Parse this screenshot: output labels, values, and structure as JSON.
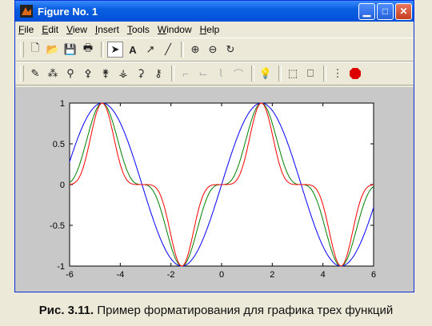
{
  "window": {
    "title": "Figure No. 1"
  },
  "menu": [
    "File",
    "Edit",
    "View",
    "Insert",
    "Tools",
    "Window",
    "Help"
  ],
  "icons": {
    "toolbar1": [
      "new-file-icon",
      "open-folder-icon",
      "save-icon",
      "print-icon",
      "select-arrow-icon",
      "text-icon",
      "arrow-icon",
      "line-icon",
      "zoom-in-icon",
      "zoom-out-icon",
      "rotate-icon"
    ],
    "toolbar2": [
      "edit-plot-icon",
      "data-points-icon",
      "tool3-icon",
      "tool4-icon",
      "tool5-icon",
      "tool6-icon",
      "tool7-icon",
      "tool8-icon",
      "tool9-icon",
      "tool10-icon",
      "tool11-icon",
      "tool12-icon",
      "lightbulb-icon",
      "box3d-icon",
      "camera-icon",
      "toggle-icon",
      "stop-icon"
    ]
  },
  "chart_data": {
    "type": "line",
    "xlim": [
      -6,
      6
    ],
    "ylim": [
      -1,
      1
    ],
    "xticks": [
      "-6",
      "-4",
      "-2",
      "0",
      "2",
      "4",
      "6"
    ],
    "yticks": [
      "1",
      "0.5",
      "0",
      "-0.5",
      "-1"
    ],
    "series": [
      {
        "color": "#0000ff",
        "formula": "sin(x)"
      },
      {
        "color": "#008000",
        "formula": "sin(x)^3"
      },
      {
        "color": "#ff0000",
        "formula": "sin(x)^5"
      }
    ]
  },
  "caption": {
    "label": "Рис. 3.11.",
    "text": " Пример форматирования для графика трех функций"
  }
}
